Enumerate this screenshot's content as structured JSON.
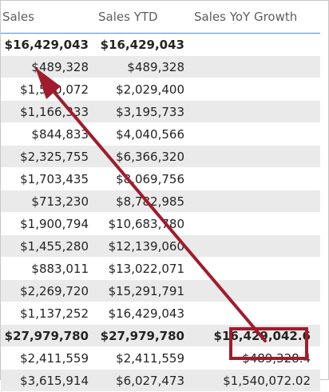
{
  "columns": [
    "Sales",
    "Sales YTD",
    "Sales YoY Growth"
  ],
  "rows": [
    {
      "sales": "$16,429,043",
      "ytd": "$16,429,043",
      "growth": "",
      "total": true,
      "shaded": false
    },
    {
      "sales": "$489,328",
      "ytd": "$489,328",
      "growth": "",
      "total": false,
      "shaded": true
    },
    {
      "sales": "$1,540,072",
      "ytd": "$2,029,400",
      "growth": "",
      "total": false,
      "shaded": false
    },
    {
      "sales": "$1,166,333",
      "ytd": "$3,195,733",
      "growth": "",
      "total": false,
      "shaded": true
    },
    {
      "sales": "$844,833",
      "ytd": "$4,040,566",
      "growth": "",
      "total": false,
      "shaded": false
    },
    {
      "sales": "$2,325,755",
      "ytd": "$6,366,320",
      "growth": "",
      "total": false,
      "shaded": true
    },
    {
      "sales": "$1,703,435",
      "ytd": "$8,069,756",
      "growth": "",
      "total": false,
      "shaded": false
    },
    {
      "sales": "$713,230",
      "ytd": "$8,782,985",
      "growth": "",
      "total": false,
      "shaded": true
    },
    {
      "sales": "$1,900,794",
      "ytd": "$10,683,780",
      "growth": "",
      "total": false,
      "shaded": false
    },
    {
      "sales": "$1,455,280",
      "ytd": "$12,139,060",
      "growth": "",
      "total": false,
      "shaded": true
    },
    {
      "sales": "$883,011",
      "ytd": "$13,022,071",
      "growth": "",
      "total": false,
      "shaded": false
    },
    {
      "sales": "$2,269,720",
      "ytd": "$15,291,791",
      "growth": "",
      "total": false,
      "shaded": true
    },
    {
      "sales": "$1,137,252",
      "ytd": "$16,429,043",
      "growth": "",
      "total": false,
      "shaded": false
    },
    {
      "sales": "$27,979,780",
      "ytd": "$27,979,780",
      "growth": "$16,429,042.6",
      "total": true,
      "shaded": true
    },
    {
      "sales": "$2,411,559",
      "ytd": "$2,411,559",
      "growth": "$489,328.4",
      "total": false,
      "shaded": false
    },
    {
      "sales": "$3,615,914",
      "ytd": "$6,027,473",
      "growth": "$1,540,072.02",
      "total": false,
      "shaded": true
    }
  ],
  "colors": {
    "shaded_row": "#eaeaea",
    "header_rule": "#4a90e2",
    "arrow": "#a01c2c",
    "highlight_box": "#a01c2c"
  }
}
